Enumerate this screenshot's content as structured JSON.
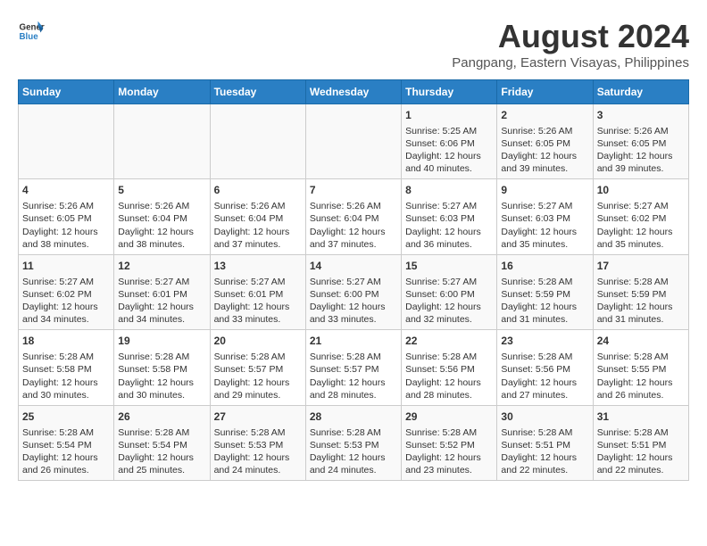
{
  "header": {
    "logo_line1": "General",
    "logo_line2": "Blue",
    "main_title": "August 2024",
    "subtitle": "Pangpang, Eastern Visayas, Philippines"
  },
  "days_of_week": [
    "Sunday",
    "Monday",
    "Tuesday",
    "Wednesday",
    "Thursday",
    "Friday",
    "Saturday"
  ],
  "weeks": [
    [
      {
        "day": "",
        "content": ""
      },
      {
        "day": "",
        "content": ""
      },
      {
        "day": "",
        "content": ""
      },
      {
        "day": "",
        "content": ""
      },
      {
        "day": "1",
        "content": "Sunrise: 5:25 AM\nSunset: 6:06 PM\nDaylight: 12 hours\nand 40 minutes."
      },
      {
        "day": "2",
        "content": "Sunrise: 5:26 AM\nSunset: 6:05 PM\nDaylight: 12 hours\nand 39 minutes."
      },
      {
        "day": "3",
        "content": "Sunrise: 5:26 AM\nSunset: 6:05 PM\nDaylight: 12 hours\nand 39 minutes."
      }
    ],
    [
      {
        "day": "4",
        "content": "Sunrise: 5:26 AM\nSunset: 6:05 PM\nDaylight: 12 hours\nand 38 minutes."
      },
      {
        "day": "5",
        "content": "Sunrise: 5:26 AM\nSunset: 6:04 PM\nDaylight: 12 hours\nand 38 minutes."
      },
      {
        "day": "6",
        "content": "Sunrise: 5:26 AM\nSunset: 6:04 PM\nDaylight: 12 hours\nand 37 minutes."
      },
      {
        "day": "7",
        "content": "Sunrise: 5:26 AM\nSunset: 6:04 PM\nDaylight: 12 hours\nand 37 minutes."
      },
      {
        "day": "8",
        "content": "Sunrise: 5:27 AM\nSunset: 6:03 PM\nDaylight: 12 hours\nand 36 minutes."
      },
      {
        "day": "9",
        "content": "Sunrise: 5:27 AM\nSunset: 6:03 PM\nDaylight: 12 hours\nand 35 minutes."
      },
      {
        "day": "10",
        "content": "Sunrise: 5:27 AM\nSunset: 6:02 PM\nDaylight: 12 hours\nand 35 minutes."
      }
    ],
    [
      {
        "day": "11",
        "content": "Sunrise: 5:27 AM\nSunset: 6:02 PM\nDaylight: 12 hours\nand 34 minutes."
      },
      {
        "day": "12",
        "content": "Sunrise: 5:27 AM\nSunset: 6:01 PM\nDaylight: 12 hours\nand 34 minutes."
      },
      {
        "day": "13",
        "content": "Sunrise: 5:27 AM\nSunset: 6:01 PM\nDaylight: 12 hours\nand 33 minutes."
      },
      {
        "day": "14",
        "content": "Sunrise: 5:27 AM\nSunset: 6:00 PM\nDaylight: 12 hours\nand 33 minutes."
      },
      {
        "day": "15",
        "content": "Sunrise: 5:27 AM\nSunset: 6:00 PM\nDaylight: 12 hours\nand 32 minutes."
      },
      {
        "day": "16",
        "content": "Sunrise: 5:28 AM\nSunset: 5:59 PM\nDaylight: 12 hours\nand 31 minutes."
      },
      {
        "day": "17",
        "content": "Sunrise: 5:28 AM\nSunset: 5:59 PM\nDaylight: 12 hours\nand 31 minutes."
      }
    ],
    [
      {
        "day": "18",
        "content": "Sunrise: 5:28 AM\nSunset: 5:58 PM\nDaylight: 12 hours\nand 30 minutes."
      },
      {
        "day": "19",
        "content": "Sunrise: 5:28 AM\nSunset: 5:58 PM\nDaylight: 12 hours\nand 30 minutes."
      },
      {
        "day": "20",
        "content": "Sunrise: 5:28 AM\nSunset: 5:57 PM\nDaylight: 12 hours\nand 29 minutes."
      },
      {
        "day": "21",
        "content": "Sunrise: 5:28 AM\nSunset: 5:57 PM\nDaylight: 12 hours\nand 28 minutes."
      },
      {
        "day": "22",
        "content": "Sunrise: 5:28 AM\nSunset: 5:56 PM\nDaylight: 12 hours\nand 28 minutes."
      },
      {
        "day": "23",
        "content": "Sunrise: 5:28 AM\nSunset: 5:56 PM\nDaylight: 12 hours\nand 27 minutes."
      },
      {
        "day": "24",
        "content": "Sunrise: 5:28 AM\nSunset: 5:55 PM\nDaylight: 12 hours\nand 26 minutes."
      }
    ],
    [
      {
        "day": "25",
        "content": "Sunrise: 5:28 AM\nSunset: 5:54 PM\nDaylight: 12 hours\nand 26 minutes."
      },
      {
        "day": "26",
        "content": "Sunrise: 5:28 AM\nSunset: 5:54 PM\nDaylight: 12 hours\nand 25 minutes."
      },
      {
        "day": "27",
        "content": "Sunrise: 5:28 AM\nSunset: 5:53 PM\nDaylight: 12 hours\nand 24 minutes."
      },
      {
        "day": "28",
        "content": "Sunrise: 5:28 AM\nSunset: 5:53 PM\nDaylight: 12 hours\nand 24 minutes."
      },
      {
        "day": "29",
        "content": "Sunrise: 5:28 AM\nSunset: 5:52 PM\nDaylight: 12 hours\nand 23 minutes."
      },
      {
        "day": "30",
        "content": "Sunrise: 5:28 AM\nSunset: 5:51 PM\nDaylight: 12 hours\nand 22 minutes."
      },
      {
        "day": "31",
        "content": "Sunrise: 5:28 AM\nSunset: 5:51 PM\nDaylight: 12 hours\nand 22 minutes."
      }
    ]
  ]
}
